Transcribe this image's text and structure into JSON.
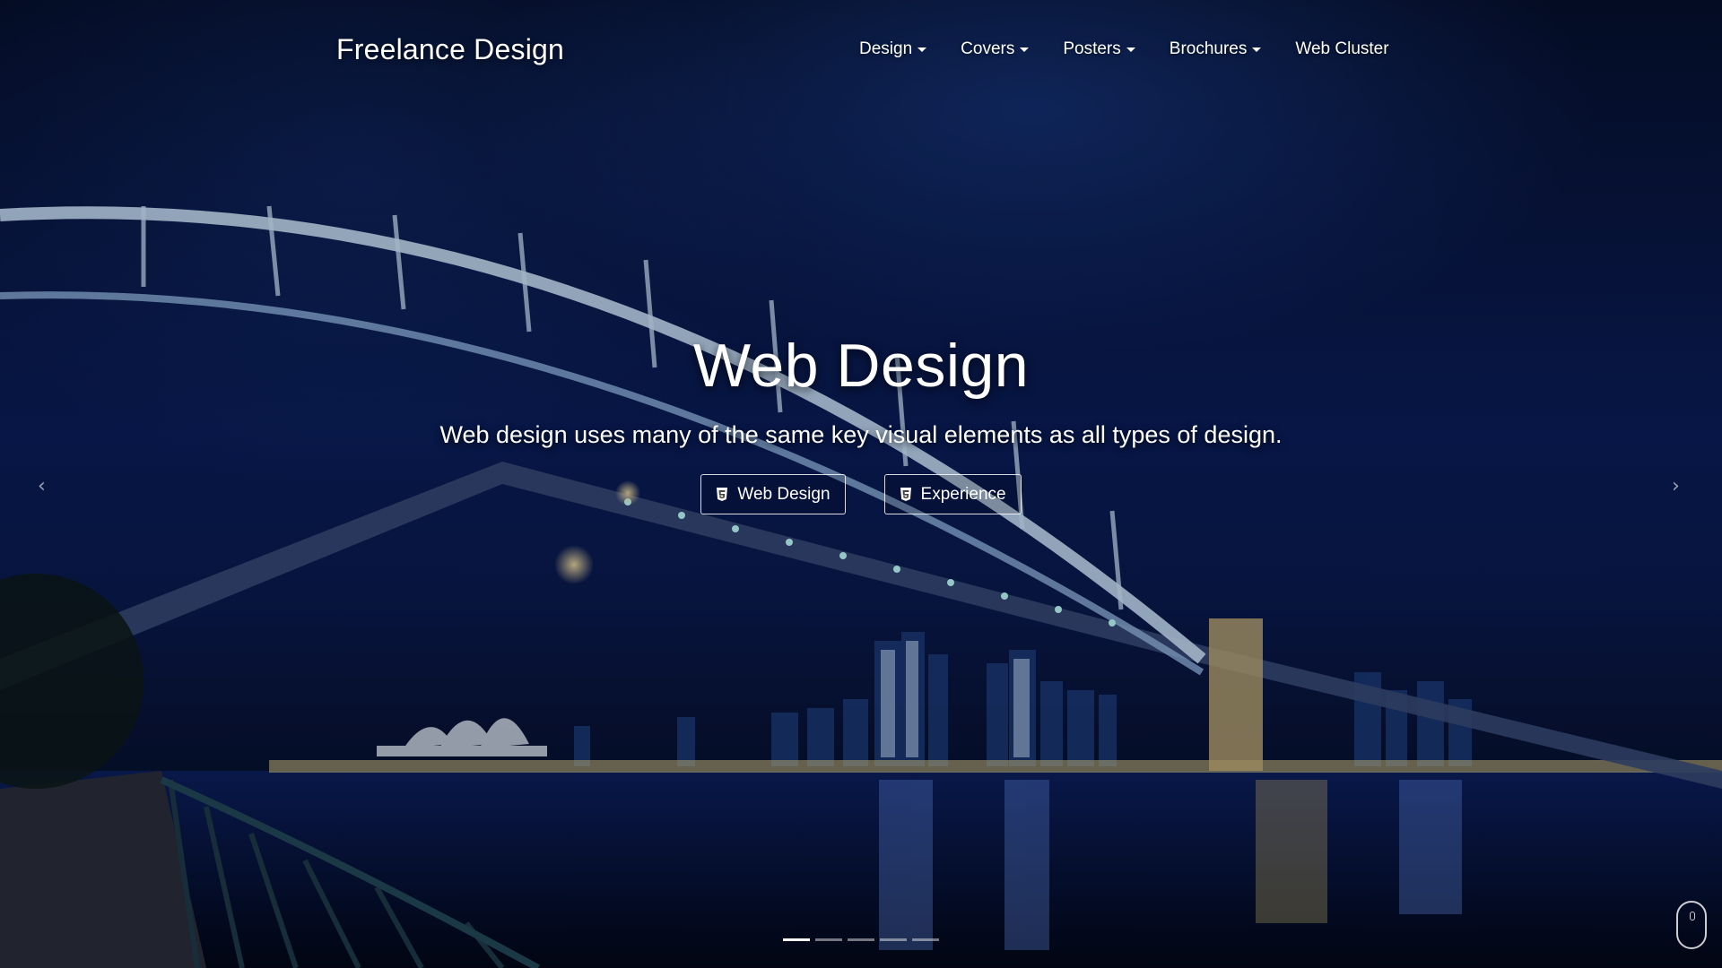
{
  "brand": "Freelance Design",
  "nav": {
    "items": [
      {
        "label": "Design",
        "dropdown": true
      },
      {
        "label": "Covers",
        "dropdown": true
      },
      {
        "label": "Posters",
        "dropdown": true
      },
      {
        "label": "Brochures",
        "dropdown": true
      },
      {
        "label": "Web Cluster",
        "dropdown": false
      }
    ]
  },
  "hero": {
    "title": "Web Design",
    "subtitle": "Web design uses many of the same key visual elements as all types of design.",
    "buttons": [
      {
        "label": "Web Design",
        "icon": "html5-icon"
      },
      {
        "label": "Experience",
        "icon": "html5-icon"
      }
    ],
    "background": "night-harbour-bridge-photo"
  },
  "carousel": {
    "prev_icon": "chevron-left-icon",
    "next_icon": "chevron-right-icon",
    "slide_count": 5,
    "active_slide": 1
  },
  "scroll_hint_icon": "mouse-scroll-icon",
  "colors": {
    "sky_dark": "#06102e",
    "sky_blue": "#0a1d5a",
    "bridge_light": "#cfe8ff",
    "text": "#ffffff"
  }
}
